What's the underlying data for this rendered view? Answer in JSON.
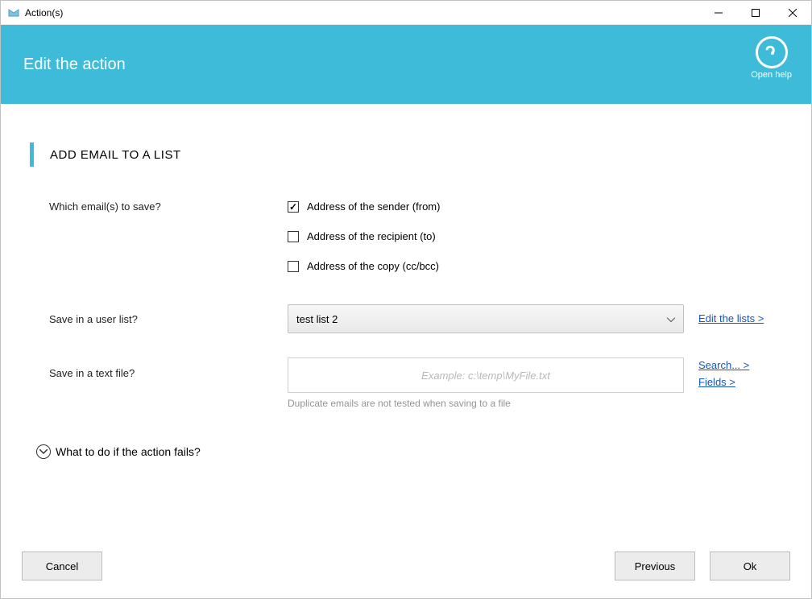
{
  "window": {
    "title": "Action(s)"
  },
  "header": {
    "title": "Edit the action",
    "help_label": "Open help"
  },
  "section": {
    "title": "ADD EMAIL TO A LIST"
  },
  "form": {
    "which_label": "Which email(s) to save?",
    "options": {
      "sender": {
        "label": "Address of the sender (from)",
        "checked": true
      },
      "recipient": {
        "label": "Address of the recipient (to)",
        "checked": false
      },
      "copy": {
        "label": "Address of the copy (cc/bcc)",
        "checked": false
      }
    },
    "user_list_label": "Save in a user list?",
    "user_list_value": "test list 2",
    "edit_lists_link": "Edit the lists >",
    "file_label": "Save in a text file?",
    "file_placeholder": "Example: c:\\temp\\MyFile.txt",
    "file_value": "",
    "file_hint": "Duplicate emails are not tested when saving to a file",
    "search_link": "Search... >",
    "fields_link": "Fields >"
  },
  "expander": {
    "label": "What to do if the action fails?"
  },
  "footer": {
    "cancel": "Cancel",
    "previous": "Previous",
    "ok": "Ok"
  }
}
